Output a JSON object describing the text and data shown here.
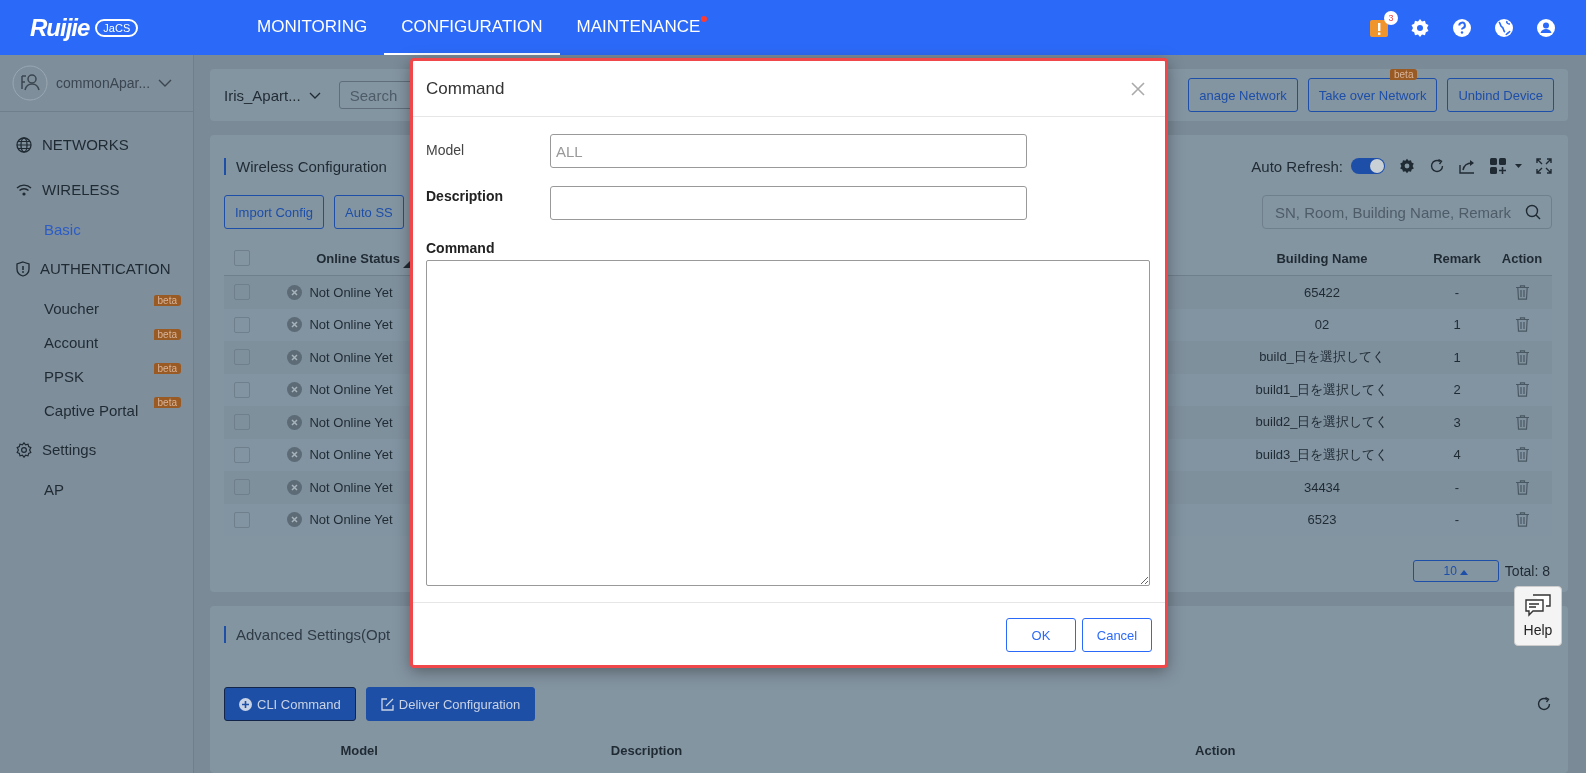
{
  "topbar": {
    "logo": {
      "brand": "Ruijie",
      "badge": "JaCS"
    },
    "nav": [
      {
        "label": "MONITORING",
        "selected": false,
        "dot": false
      },
      {
        "label": "CONFIGURATION",
        "selected": true,
        "dot": false
      },
      {
        "label": "MAINTENANCE",
        "selected": false,
        "dot": true
      }
    ],
    "alert_count": "3"
  },
  "sidebar": {
    "account": "commonApar...",
    "groups": [
      {
        "label": "NETWORKS"
      },
      {
        "label": "WIRELESS",
        "children": [
          {
            "label": "Basic",
            "selected": true
          }
        ]
      },
      {
        "label": "AUTHENTICATION",
        "children": [
          {
            "label": "Voucher",
            "selected": false,
            "badge": "beta"
          },
          {
            "label": "Account",
            "selected": false,
            "badge": "beta"
          },
          {
            "label": "PPSK",
            "selected": false,
            "badge": "beta"
          },
          {
            "label": "Captive Portal",
            "selected": false,
            "badge": "beta"
          }
        ]
      },
      {
        "label": "Settings",
        "children": [
          {
            "label": "AP",
            "selected": false
          }
        ]
      }
    ]
  },
  "filter_bar": {
    "network": "Iris_Apart...",
    "search": {
      "placeholder": "Search"
    },
    "buttons": [
      {
        "label": "anage Network"
      },
      {
        "label": "Take over Network",
        "badge": "beta"
      },
      {
        "label": "Unbind Device"
      }
    ]
  },
  "wireless": {
    "title": "Wireless Configuration",
    "auto_refresh": {
      "label": "Auto Refresh:",
      "on": true
    },
    "buttons": [
      "Import Config",
      "Auto SS"
    ],
    "search": {
      "placeholder": "SN, Room, Building Name, Remark"
    },
    "table": {
      "all_checked": false,
      "columns": [
        "Online Status",
        "Building Name",
        "Remark",
        "Action"
      ],
      "rows": [
        {
          "checked": false,
          "status": "Not Online Yet",
          "building": "65422",
          "remark": "-"
        },
        {
          "checked": false,
          "status": "Not Online Yet",
          "building": "02",
          "remark": "1"
        },
        {
          "checked": false,
          "status": "Not Online Yet",
          "building": "build_日を選択してく",
          "remark": "1"
        },
        {
          "checked": false,
          "status": "Not Online Yet",
          "building": "build1_日を選択してく",
          "remark": "2"
        },
        {
          "checked": false,
          "status": "Not Online Yet",
          "building": "build2_日を選択してく",
          "remark": "3"
        },
        {
          "checked": false,
          "status": "Not Online Yet",
          "building": "build3_日を選択してく",
          "remark": "4"
        },
        {
          "checked": false,
          "status": "Not Online Yet",
          "building": "34434",
          "remark": "-"
        },
        {
          "checked": false,
          "status": "Not Online Yet",
          "building": "6523",
          "remark": "-"
        }
      ]
    },
    "page_size": "10",
    "total": "Total: 8"
  },
  "advanced": {
    "title": "Advanced Settings(Opt",
    "buttons": [
      "CLI Command",
      "Deliver Configuration"
    ],
    "columns": [
      "Model",
      "Description",
      "Action"
    ]
  },
  "dialog": {
    "title": "Command",
    "fields": [
      {
        "label": "Model",
        "kind": "input",
        "bold": false,
        "placeholder": "ALL"
      },
      {
        "label": "Description",
        "kind": "input",
        "bold": true
      },
      {
        "label": "Command",
        "kind": "textarea",
        "bold": true
      }
    ],
    "buttons": [
      "OK",
      "Cancel"
    ]
  },
  "help": {
    "label": "Help"
  }
}
